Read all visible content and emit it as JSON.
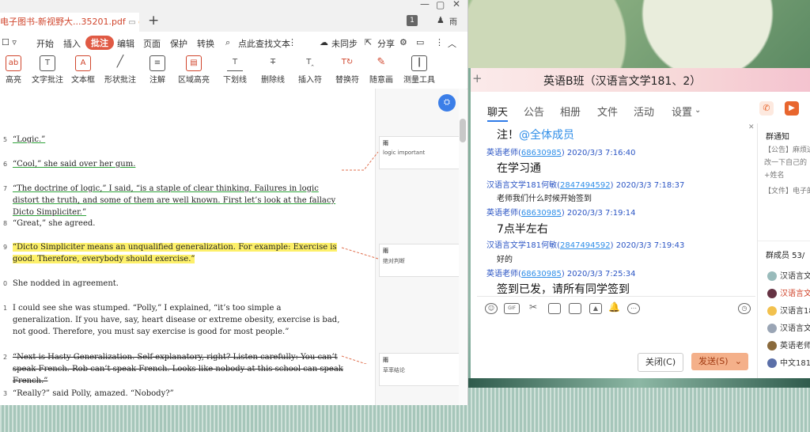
{
  "pdf": {
    "tab_title": "电子图书-新视野大...35201.pdf",
    "menu": [
      "开始",
      "插入",
      "批注",
      "编辑",
      "页面",
      "保护",
      "转换"
    ],
    "search_placeholder": "点此查找文本",
    "sync": "未同步",
    "share": "分享",
    "badge": "1",
    "tools": [
      "高亮",
      "文字批注",
      "文本框",
      "形状批注",
      "注解",
      "区域高亮",
      "下划线",
      "删除线",
      "插入符",
      "替换符",
      "随意画",
      "测量工具"
    ],
    "paragraphs": [
      {
        "num": "5",
        "text": "“Logic.”"
      },
      {
        "num": "6",
        "text": "“Cool,” she said over her gum."
      },
      {
        "num": "7",
        "text": "“The doctrine of logic,” I said, “is a staple of clear thinking. Failures in logic distort the truth, and some of them are well known. First let’s look at the fallacy Dicto Simpliciter.”"
      },
      {
        "num": "8",
        "text": "“Great,” she agreed."
      },
      {
        "num": "9",
        "text": "“Dicto Simpliciter means an unqualified generalization. For example: Exercise is good. Therefore, everybody should exercise.”"
      },
      {
        "num": "0",
        "text": "She nodded in agreement."
      },
      {
        "num": "1",
        "text": "I could see she was stumped. “Polly,” I explained, “it’s too simple a generalization. If you have, say, heart disease or extreme obesity, exercise is bad, not good. Therefore, you must say exercise is good for most people.”"
      },
      {
        "num": "2",
        "text": "“Next is Hasty Generalization. Self-explanatory, right? Listen carefully: You can’t speak French. Rob can’t speak French. Looks like nobody at this school can speak French.”"
      },
      {
        "num": "3",
        "text": "“Really?” said Polly, amazed. “Nobody?”"
      }
    ],
    "notes": [
      {
        "author": "雨",
        "text": "logic important"
      },
      {
        "author": "雨",
        "text": "绝对判断"
      },
      {
        "author": "雨",
        "text": "草率结论"
      }
    ]
  },
  "chat": {
    "title": "英语B班（汉语言文学181、2）",
    "tabs": [
      "聊天",
      "公告",
      "相册",
      "文件",
      "活动",
      "设置"
    ],
    "messages": [
      {
        "kind": "big",
        "text": "注！",
        "mention": "@全体成员"
      },
      {
        "kind": "meta",
        "name": "英语老师(",
        "id": "68630985",
        "rest": ") 2020/3/3 7:16:40"
      },
      {
        "kind": "big",
        "text": "在学习通"
      },
      {
        "kind": "meta",
        "name": "汉语言文学181何敏(",
        "id": "2847494592",
        "rest": ") 2020/3/3 7:18:37"
      },
      {
        "kind": "small",
        "text": "老师我们什么时候开始签到"
      },
      {
        "kind": "meta",
        "name": "英语老师(",
        "id": "68630985",
        "rest": ") 2020/3/3 7:19:14"
      },
      {
        "kind": "big",
        "text": "7点半左右"
      },
      {
        "kind": "meta",
        "name": "汉语言文学181何敏(",
        "id": "2847494592",
        "rest": ") 2020/3/3 7:19:43"
      },
      {
        "kind": "small",
        "text": "好的"
      },
      {
        "kind": "meta",
        "name": "英语老师(",
        "id": "68630985",
        "rest": ") 2020/3/3 7:25:34"
      },
      {
        "kind": "big",
        "text": "签到已发，请所有同学签到"
      }
    ],
    "close_label": "关闭(C)",
    "send_label": "发送(S)",
    "side": {
      "notice_title": "群通知",
      "notice_lines": [
        "【公告】麻烦进",
        "改一下自己的",
        "+姓名",
        "【文件】电子的"
      ],
      "members_title": "群成员 53/",
      "members": [
        "汉语言文",
        "汉语言文",
        "汉语言18",
        "汉语言文",
        "英语老师",
        "中文181"
      ]
    }
  }
}
